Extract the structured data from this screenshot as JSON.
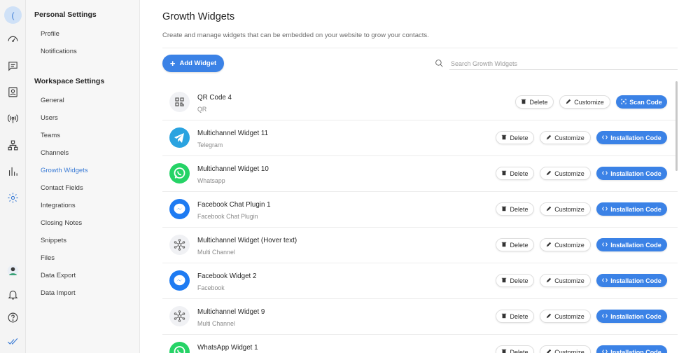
{
  "rail": {
    "avatar_initial": "(",
    "icons": [
      "dashboard-icon",
      "messages-icon",
      "contacts-icon",
      "broadcast-icon",
      "workflows-icon",
      "reports-icon",
      "settings-icon"
    ],
    "bottom_icons": [
      "user-avatar",
      "bell-icon",
      "help-icon",
      "checkmarks-logo-icon"
    ]
  },
  "menu": {
    "personal_heading": "Personal Settings",
    "personal_items": [
      "Profile",
      "Notifications"
    ],
    "workspace_heading": "Workspace Settings",
    "workspace_items": [
      "General",
      "Users",
      "Teams",
      "Channels",
      "Growth Widgets",
      "Contact Fields",
      "Integrations",
      "Closing Notes",
      "Snippets",
      "Files",
      "Data Export",
      "Data Import"
    ],
    "active_item": "Growth Widgets"
  },
  "header": {
    "title": "Growth Widgets",
    "subtitle": "Create and manage widgets that can be embedded on your website to grow your contacts."
  },
  "toolbar": {
    "add_label": "Add Widget",
    "search_placeholder": "Search Growth Widgets"
  },
  "actions": {
    "delete": "Delete",
    "customize": "Customize",
    "scan": "Scan Code",
    "install": "Installation Code"
  },
  "widgets": [
    {
      "name": "QR Code 4",
      "type": "QR",
      "icon": "qr-icon",
      "action": "Scan Code"
    },
    {
      "name": "Multichannel Widget 11",
      "type": "Telegram",
      "icon": "telegram-icon",
      "action": "Installation Code"
    },
    {
      "name": "Multichannel Widget 10",
      "type": "Whatsapp",
      "icon": "whatsapp-icon",
      "action": "Installation Code"
    },
    {
      "name": "Facebook Chat Plugin 1",
      "type": "Facebook Chat Plugin",
      "icon": "messenger-icon",
      "action": "Installation Code"
    },
    {
      "name": "Multichannel Widget (Hover text)",
      "type": "Multi Channel",
      "icon": "multichannel-icon",
      "action": "Installation Code"
    },
    {
      "name": "Facebook Widget 2",
      "type": "Facebook",
      "icon": "messenger-icon",
      "action": "Installation Code"
    },
    {
      "name": "Multichannel Widget 9",
      "type": "Multi Channel",
      "icon": "multichannel-icon",
      "action": "Installation Code"
    },
    {
      "name": "WhatsApp Widget 1",
      "type": "",
      "icon": "whatsapp-icon",
      "action": "Installation Code"
    }
  ],
  "colors": {
    "accent": "#3b82e6",
    "telegram": "#2aa3e0",
    "whatsapp": "#25d366",
    "messenger": "#1e7bf2"
  }
}
